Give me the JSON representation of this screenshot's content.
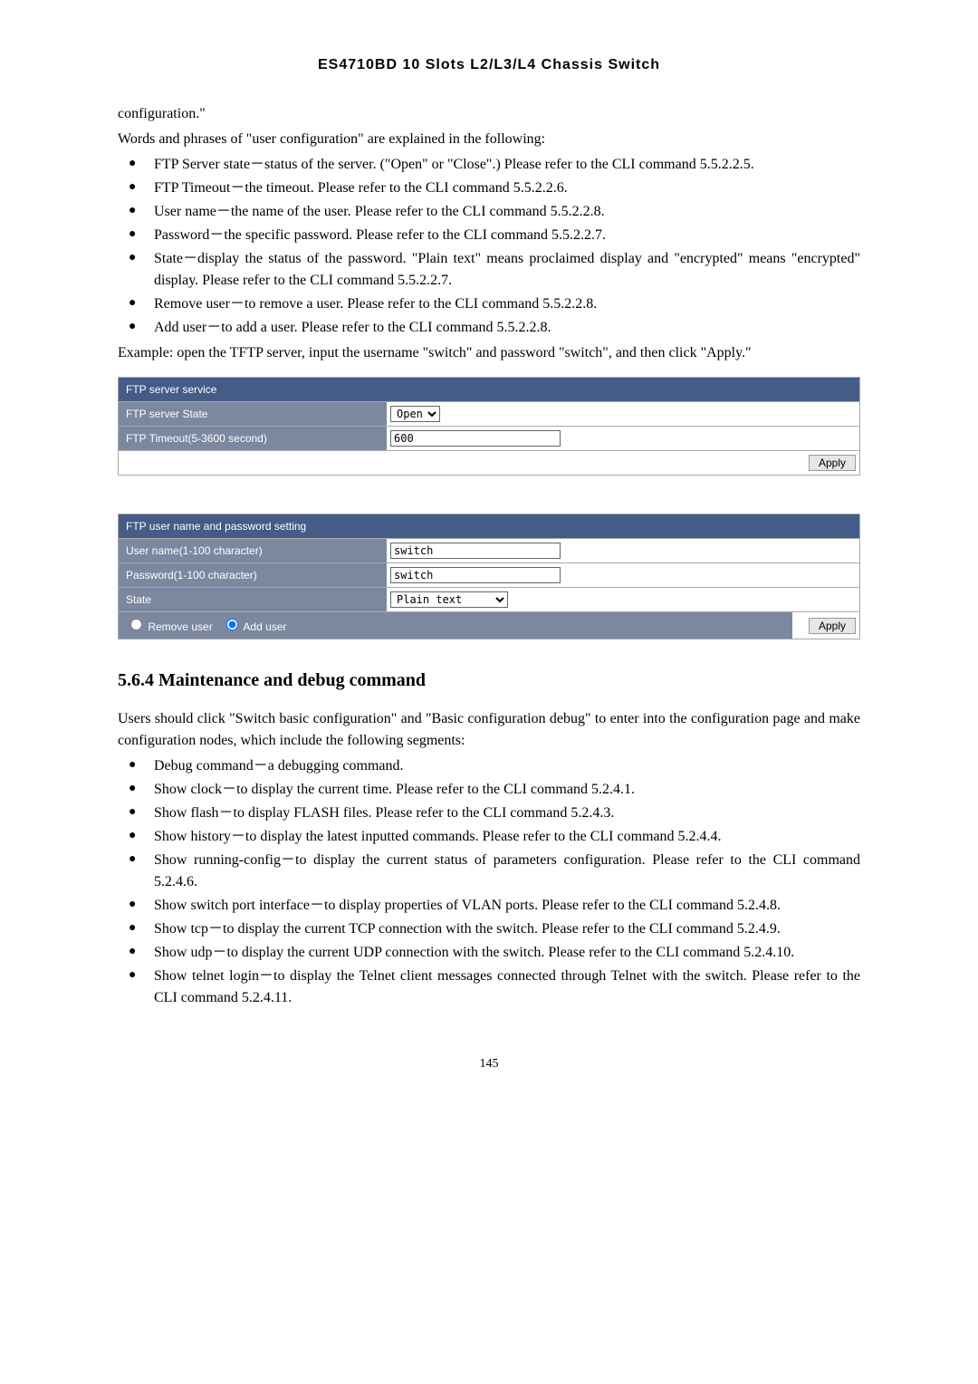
{
  "header": "ES4710BD 10 Slots L2/L3/L4 Chassis Switch",
  "p_configuration": "configuration.\"",
  "p_words": "Words and phrases of \"user configuration\" are explained in the following:",
  "bl1": [
    "FTP Server state－status of the server. (\"Open\" or \"Close\".) Please refer to the CLI command 5.5.2.2.5.",
    "FTP Timeout－the timeout. Please refer to the CLI command 5.5.2.2.6.",
    "User name－the name of the user. Please refer to the CLI command 5.5.2.2.8.",
    "Password－the specific password. Please refer to the CLI command 5.5.2.2.7.",
    "State－display the status of the password. \"Plain text\" means proclaimed display and \"encrypted\" means \"encrypted\" display. Please refer to the CLI command 5.5.2.2.7.",
    "Remove user－to remove a user. Please refer to the CLI command 5.5.2.2.8.",
    "Add user－to add a user. Please refer to the CLI command 5.5.2.2.8."
  ],
  "p_example": "Example: open the TFTP server, input the username \"switch\" and password \"switch\", and then click \"Apply.\"",
  "form1": {
    "title": "FTP server service",
    "state_label": "FTP server State",
    "state_value": "Open",
    "timeout_label": "FTP Timeout(5-3600 second)",
    "timeout_value": "600",
    "apply": "Apply"
  },
  "form2": {
    "title": "FTP user name and password setting",
    "user_label": "User name(1-100 character)",
    "user_value": "switch",
    "pass_label": "Password(1-100 character)",
    "pass_value": "switch",
    "state_label": "State",
    "state_value": "Plain text",
    "remove": "Remove user",
    "add": "Add user",
    "apply": "Apply"
  },
  "section_heading": "5.6.4  Maintenance and debug command",
  "p_users": "Users should click \"Switch basic configuration\" and \"Basic configuration debug\" to enter into the configuration page and make configuration nodes, which include the following segments:",
  "bl2": [
    "Debug command－a debugging command.",
    "Show clock－to display the current time. Please refer to the CLI command 5.2.4.1.",
    "Show flash－to display FLASH files. Please refer to the CLI command 5.2.4.3.",
    "Show history－to display the latest inputted commands. Please refer to the CLI command 5.2.4.4.",
    "Show running-config－to display the current status of parameters configuration. Please refer to the CLI command 5.2.4.6.",
    "Show switch port interface－to display properties of VLAN ports. Please refer to the CLI command 5.2.4.8.",
    "Show tcp－to display the current TCP connection with the switch. Please refer to the CLI command 5.2.4.9.",
    "Show udp－to display the current UDP connection with the switch. Please refer to the CLI command 5.2.4.10.",
    "Show telnet login－to display the Telnet client messages connected through Telnet with the switch. Please refer to the CLI command 5.2.4.11."
  ],
  "page_number": "145"
}
